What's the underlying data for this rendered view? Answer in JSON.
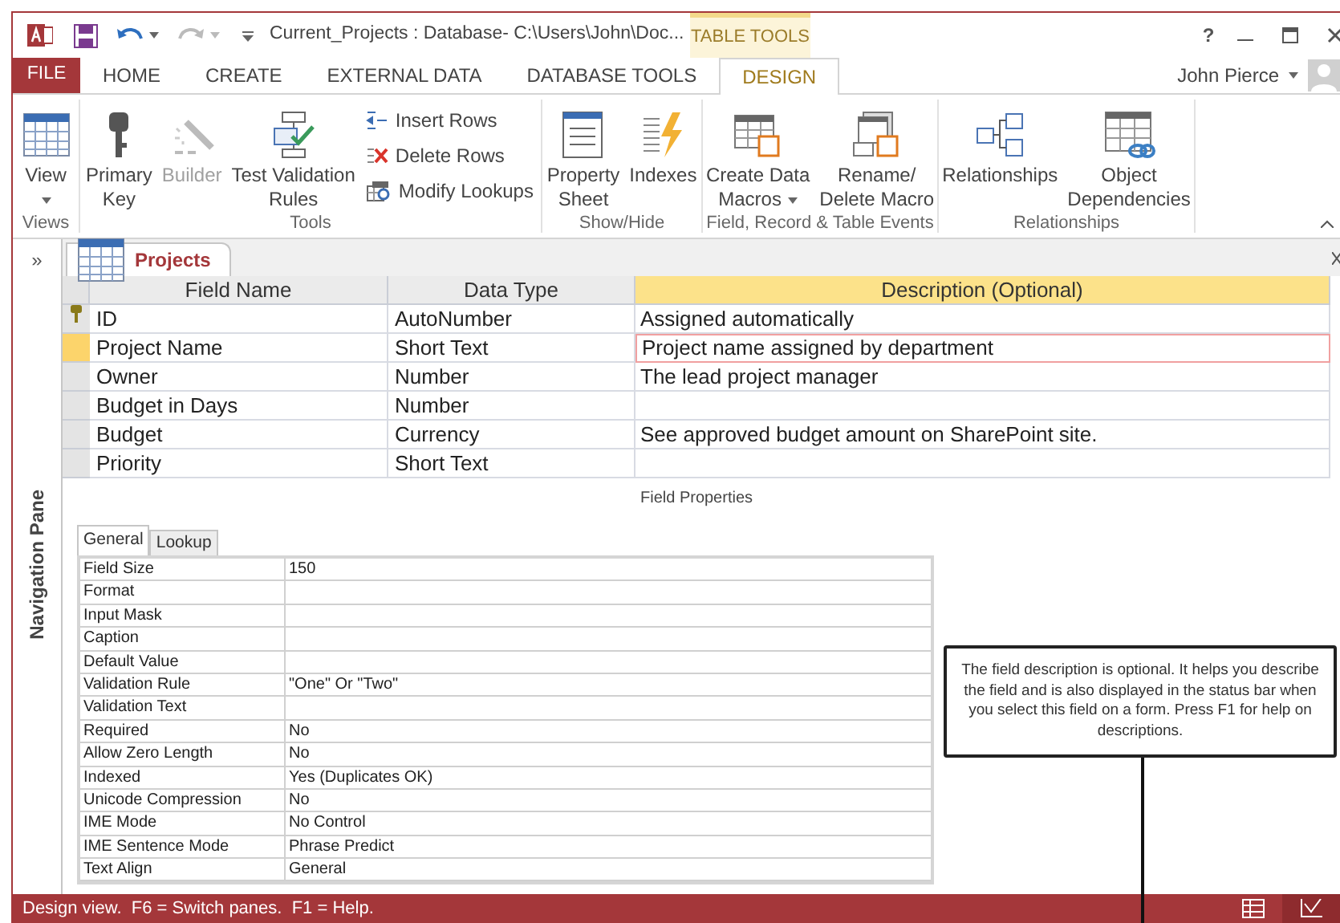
{
  "window": {
    "title": "Current_Projects : Database- C:\\Users\\John\\Doc...",
    "help": "?"
  },
  "contextual_group": {
    "label": "TABLE TOOLS"
  },
  "ribbon_tabs": [
    {
      "label": "FILE",
      "kind": "file",
      "selected": false
    },
    {
      "label": "HOME",
      "kind": "tab",
      "selected": false
    },
    {
      "label": "CREATE",
      "kind": "tab",
      "selected": false
    },
    {
      "label": "EXTERNAL DATA",
      "kind": "tab",
      "selected": false
    },
    {
      "label": "DATABASE TOOLS",
      "kind": "tab",
      "selected": false
    },
    {
      "label": "DESIGN",
      "kind": "tab",
      "selected": true
    }
  ],
  "user": {
    "name": "John Pierce"
  },
  "ribbon_groups": [
    {
      "label": "Views",
      "commands": [
        {
          "kind": "large",
          "lines": [
            "View"
          ],
          "dropdown": true,
          "disabled": false
        }
      ]
    },
    {
      "label": "Tools",
      "commands": [
        {
          "kind": "large",
          "lines": [
            "Primary",
            "Key"
          ],
          "dropdown": false,
          "disabled": false
        },
        {
          "kind": "large",
          "lines": [
            "Builder"
          ],
          "dropdown": false,
          "disabled": true
        },
        {
          "kind": "large",
          "lines": [
            "Test Validation",
            "Rules"
          ],
          "dropdown": false,
          "disabled": false
        },
        {
          "kind": "small",
          "lines": [
            "Insert Rows"
          ],
          "dropdown": false,
          "disabled": false
        },
        {
          "kind": "small",
          "lines": [
            "Delete Rows"
          ],
          "dropdown": false,
          "disabled": false
        },
        {
          "kind": "small",
          "lines": [
            "Modify Lookups"
          ],
          "dropdown": false,
          "disabled": false
        }
      ]
    },
    {
      "label": "Show/Hide",
      "commands": [
        {
          "kind": "large",
          "lines": [
            "Property",
            "Sheet"
          ],
          "dropdown": false,
          "disabled": false
        },
        {
          "kind": "large",
          "lines": [
            "Indexes"
          ],
          "dropdown": false,
          "disabled": false
        }
      ]
    },
    {
      "label": "Field, Record & Table Events",
      "commands": [
        {
          "kind": "large",
          "lines": [
            "Create Data",
            "Macros"
          ],
          "dropdown": true,
          "disabled": false
        },
        {
          "kind": "large",
          "lines": [
            "Rename/",
            "Delete Macro"
          ],
          "dropdown": false,
          "disabled": false
        }
      ]
    },
    {
      "label": "Relationships",
      "commands": [
        {
          "kind": "large",
          "lines": [
            "Relationships"
          ],
          "dropdown": false,
          "disabled": false
        },
        {
          "kind": "large",
          "lines": [
            "Object",
            "Dependencies"
          ],
          "dropdown": false,
          "disabled": false
        }
      ]
    }
  ],
  "navigation_pane": {
    "toggle": "»",
    "label": "Navigation Pane"
  },
  "document_tab": {
    "label": "Projects"
  },
  "table": {
    "columns": [
      {
        "label": "Field Name",
        "selected": false
      },
      {
        "label": "Data Type",
        "selected": false
      },
      {
        "label": "Description (Optional)",
        "selected": true
      }
    ],
    "rows": [
      {
        "field_name": "ID",
        "data_type": "AutoNumber",
        "description": "Assigned automatically",
        "primary_key": true,
        "selected": false
      },
      {
        "field_name": "Project Name",
        "data_type": "Short Text",
        "description": "Project name assigned by department",
        "primary_key": false,
        "selected": true
      },
      {
        "field_name": "Owner",
        "data_type": "Number",
        "description": "The lead project manager",
        "primary_key": false,
        "selected": false
      },
      {
        "field_name": "Budget in Days",
        "data_type": "Number",
        "primary_key": false,
        "selected": false
      },
      {
        "field_name": "Budget",
        "data_type": "Currency",
        "description": "See approved budget amount on SharePoint site.",
        "primary_key": false,
        "selected": false
      },
      {
        "field_name": "Priority",
        "data_type": "Short Text",
        "primary_key": false,
        "selected": false
      }
    ]
  },
  "field_properties": {
    "title": "Field Properties",
    "tabs": [
      {
        "label": "General",
        "selected": true
      },
      {
        "label": "Lookup",
        "selected": false
      }
    ],
    "properties": [
      {
        "label": "Field Size",
        "value": "150"
      },
      {
        "label": "Format"
      },
      {
        "label": "Input Mask"
      },
      {
        "label": "Caption"
      },
      {
        "label": "Default Value"
      },
      {
        "label": "Validation Rule",
        "value": "\"One\" Or \"Two\""
      },
      {
        "label": "Validation Text"
      },
      {
        "label": "Required",
        "value": "No"
      },
      {
        "label": "Allow Zero Length",
        "value": "No"
      },
      {
        "label": "Indexed",
        "value": "Yes (Duplicates OK)"
      },
      {
        "label": "Unicode Compression",
        "value": "No"
      },
      {
        "label": "IME Mode",
        "value": "No Control"
      },
      {
        "label": "IME Sentence Mode",
        "value": "Phrase Predict"
      },
      {
        "label": "Text Align",
        "value": "General"
      }
    ]
  },
  "callout": {
    "text": "The field description is optional. It helps you describe the field and is also displayed in the status bar when you select this field on a form. Press F1 for help on descriptions."
  },
  "status_bar": {
    "text": "Design view.  F6 = Switch panes.  F1 = Help.",
    "view_buttons": [
      {
        "selected": false
      },
      {
        "selected": true
      }
    ]
  }
}
